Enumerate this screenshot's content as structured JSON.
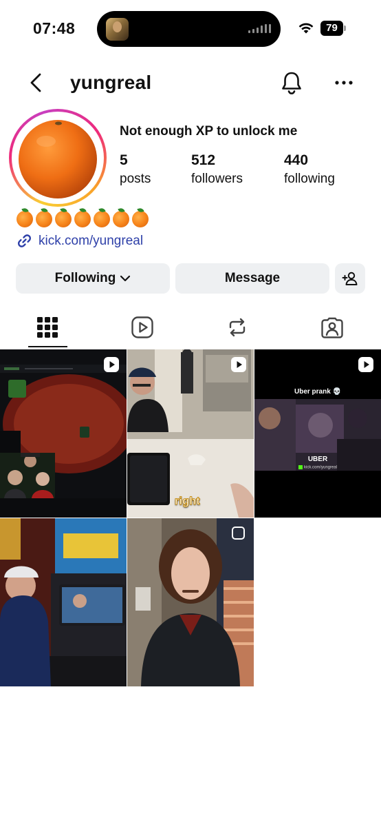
{
  "status_bar": {
    "time": "07:48",
    "battery": "79"
  },
  "header": {
    "username": "yungreal",
    "icons": [
      "back-arrow-icon",
      "bell-icon",
      "more-horizontal-icon"
    ]
  },
  "profile": {
    "bio_name": "Not enough XP to unlock me",
    "stats": [
      {
        "value": "5",
        "label": "posts"
      },
      {
        "value": "512",
        "label": "followers"
      },
      {
        "value": "440",
        "label": "following"
      }
    ],
    "emoji_count": 7,
    "emoji_icon": "orange-emoji",
    "link": "kick.com/yungreal"
  },
  "actions": {
    "following_label": "Following",
    "message_label": "Message"
  },
  "tabs": [
    {
      "name": "grid-icon",
      "active": true
    },
    {
      "name": "reels-icon",
      "active": false
    },
    {
      "name": "reposts-icon",
      "active": false
    },
    {
      "name": "tagged-icon",
      "active": false
    }
  ],
  "posts": [
    {
      "type": "reel",
      "caption": ""
    },
    {
      "type": "reel",
      "caption": "right"
    },
    {
      "type": "reel",
      "title": "Uber prank 💀",
      "caption": "UBER",
      "subcaption": "kick.com/yungreal"
    },
    {
      "type": "post",
      "caption": ""
    },
    {
      "type": "post",
      "caption": ""
    }
  ]
}
